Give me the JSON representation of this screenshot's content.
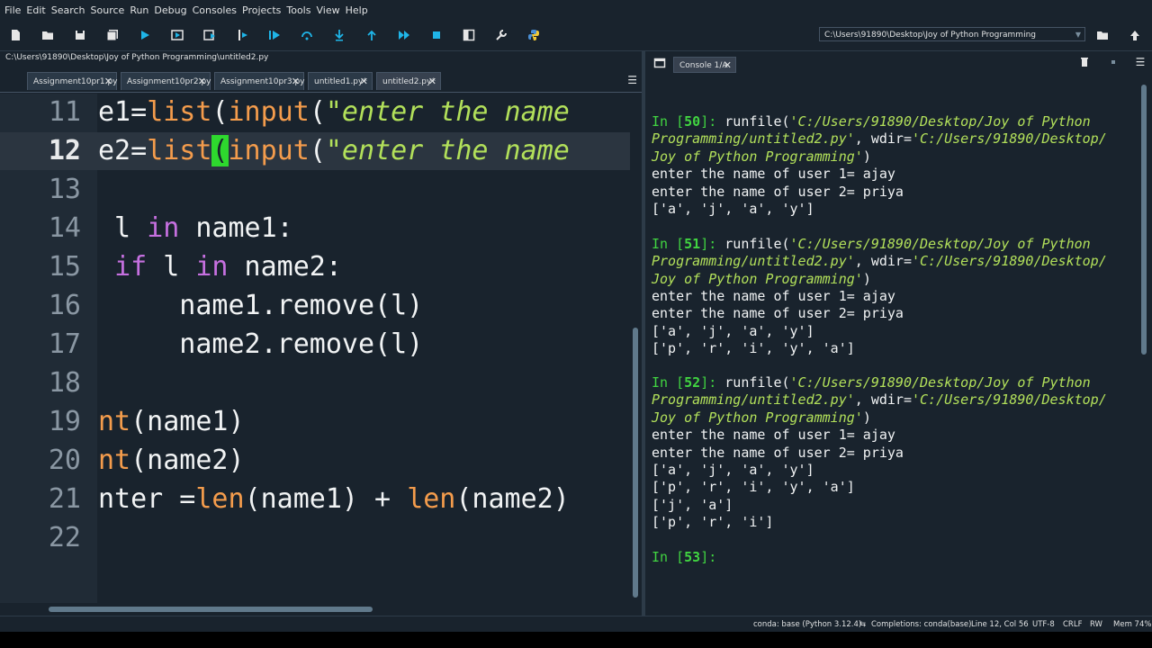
{
  "menu": [
    "File",
    "Edit",
    "Search",
    "Source",
    "Run",
    "Debug",
    "Consoles",
    "Projects",
    "Tools",
    "View",
    "Help"
  ],
  "toolbar": {
    "icons": [
      "new-file-icon",
      "open-file-icon",
      "save-icon",
      "save-all-icon",
      "run-icon",
      "run-cell-icon",
      "run-cell-advance-icon",
      "run-selection-icon",
      "debug-icon",
      "step-over-icon",
      "step-into-icon",
      "step-return-icon",
      "continue-icon",
      "stop-icon",
      "maximize-pane-icon",
      "preferences-icon",
      "python-path-icon"
    ],
    "working_dir": "C:\\Users\\91890\\Desktop\\Joy of Python Programming"
  },
  "editor": {
    "file_path": "C:\\Users\\91890\\Desktop\\Joy of Python Programming\\untitled2.py",
    "tabs": [
      {
        "label": "Assignment10pr1.py"
      },
      {
        "label": "Assignment10pr2.py"
      },
      {
        "label": "Assignment10pr3.py"
      },
      {
        "label": "untitled1.py*"
      },
      {
        "label": "untitled2.py*",
        "active": true
      }
    ],
    "current_line": 12,
    "lines": [
      {
        "num": "11"
      },
      {
        "num": "12"
      },
      {
        "num": "13"
      },
      {
        "num": "14"
      },
      {
        "num": "15"
      },
      {
        "num": "16"
      },
      {
        "num": "17"
      },
      {
        "num": "18"
      },
      {
        "num": "19"
      },
      {
        "num": "20"
      },
      {
        "num": "21"
      },
      {
        "num": "22"
      }
    ],
    "code": {
      "l11": {
        "a": "e1=",
        "b": "list",
        "c": "(",
        "d": "input",
        "e": "(",
        "f": "\"enter the name"
      },
      "l12": {
        "a": "e2=",
        "b": "list",
        "c": "(",
        "d": "input",
        "e": "(",
        "f": "\"enter the name"
      },
      "l14": {
        "a": " l ",
        "b": "in",
        "c": " name1:"
      },
      "l15": {
        "a": " ",
        "b": "if",
        "c": " l ",
        "d": "in",
        "e": " name2:"
      },
      "l16": {
        "a": "     name1.remove(l)"
      },
      "l17": {
        "a": "     name2.remove(l)"
      },
      "l19": {
        "a": "nt",
        "b": "(name1)"
      },
      "l20": {
        "a": "nt",
        "b": "(name2)"
      },
      "l21": {
        "a": "nter =",
        "b": "len",
        "c": "(name1) + ",
        "d": "len",
        "e": "(name2)"
      }
    }
  },
  "console": {
    "tab_label": "Console 1/A",
    "blocks": [
      {
        "prompt_num": "50",
        "cmd1": "runfile(",
        "path1": "'C:/Users/91890/Desktop/Joy of Python",
        "path1b": "Programming/untitled2.py'",
        "wdir": ", wdir=",
        "path2": "'C:/Users/91890/Desktop/",
        "path2b": "Joy of Python Programming'",
        "close": ")",
        "output": [
          "enter the name of user 1= ajay",
          "enter the name of user 2= priya",
          "['a', 'j', 'a', 'y']"
        ]
      },
      {
        "prompt_num": "51",
        "cmd1": "runfile(",
        "path1": "'C:/Users/91890/Desktop/Joy of Python",
        "path1b": "Programming/untitled2.py'",
        "wdir": ", wdir=",
        "path2": "'C:/Users/91890/Desktop/",
        "path2b": "Joy of Python Programming'",
        "close": ")",
        "output": [
          "enter the name of user 1= ajay",
          "enter the name of user 2= priya",
          "['a', 'j', 'a', 'y']",
          "['p', 'r', 'i', 'y', 'a']"
        ]
      },
      {
        "prompt_num": "52",
        "cmd1": "runfile(",
        "path1": "'C:/Users/91890/Desktop/Joy of Python",
        "path1b": "Programming/untitled2.py'",
        "wdir": ", wdir=",
        "path2": "'C:/Users/91890/Desktop/",
        "path2b": "Joy of Python Programming'",
        "close": ")",
        "output": [
          "enter the name of user 1= ajay",
          "enter the name of user 2= priya",
          "['a', 'j', 'a', 'y']",
          "['p', 'r', 'i', 'y', 'a']",
          "['j', 'a']",
          "['p', 'r', 'i']"
        ]
      }
    ],
    "final_prompt": "53",
    "prompt_prefix": "In [",
    "prompt_suffix": "]: "
  },
  "status": {
    "conda": "conda: base (Python 3.12.4)",
    "completions": "Completions: conda(base)",
    "position": "Line 12, Col 56",
    "encoding": "UTF-8",
    "eol": "CRLF",
    "rw": "RW",
    "mem": "Mem 74%"
  }
}
